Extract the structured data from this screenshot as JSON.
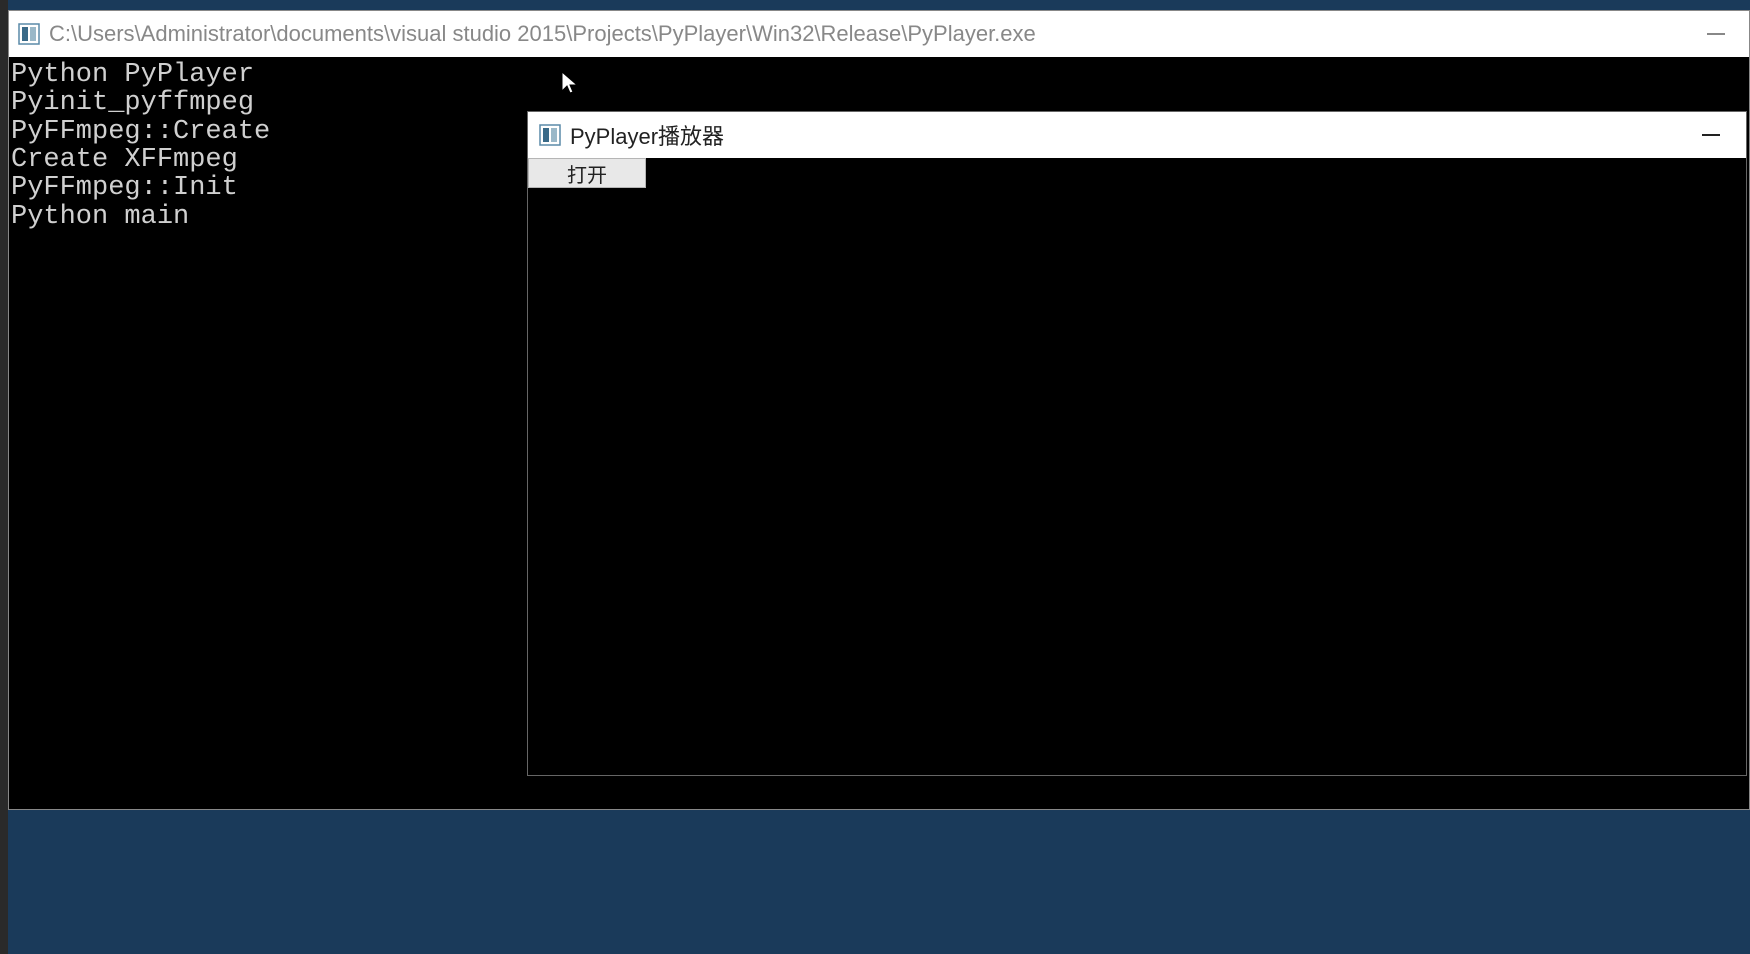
{
  "console": {
    "title": "C:\\Users\\Administrator\\documents\\visual studio 2015\\Projects\\PyPlayer\\Win32\\Release\\PyPlayer.exe",
    "lines": [
      "Python PyPlayer",
      "Pyinit_pyffmpeg",
      "PyFFmpeg::Create",
      "Create XFFmpeg",
      "PyFFmpeg::Init",
      "Python main"
    ]
  },
  "player": {
    "title": "PyPlayer播放器",
    "open_button_label": "打开"
  }
}
